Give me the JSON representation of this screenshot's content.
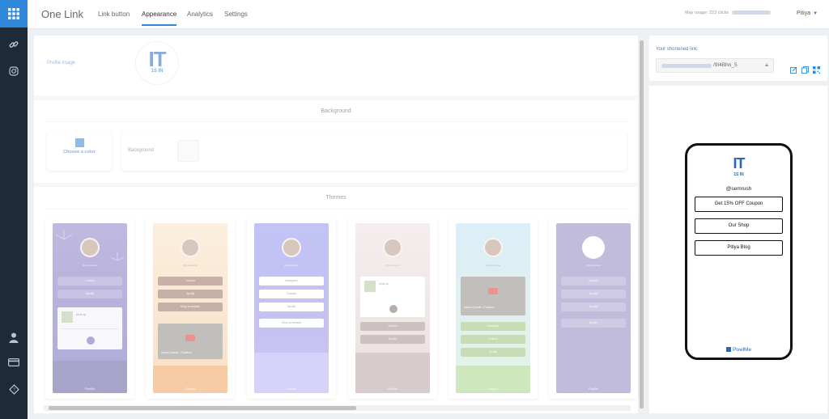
{
  "app": {
    "title": "One Link"
  },
  "tabs": [
    {
      "label": "Link button"
    },
    {
      "label": "Appearance"
    },
    {
      "label": "Analytics"
    },
    {
      "label": "Settings"
    }
  ],
  "header": {
    "usage_label": "May usage: 223 clicks",
    "user_name": "Pitiya"
  },
  "sidebar": {
    "icons": [
      "apps-grid-icon",
      "link-icon",
      "instagram-icon",
      "user-icon",
      "card-icon",
      "help-icon"
    ]
  },
  "profile": {
    "label": "Profile image",
    "logo_text": "IT",
    "logo_sub": "1S IN"
  },
  "background": {
    "title": "Background",
    "choose_label": "Choose a color",
    "field_label": "Background",
    "swatch_color": "#2f88d9"
  },
  "themes": {
    "title": "Themes",
    "handle": "@brandname",
    "footer": "PixelMe",
    "items": [
      {
        "buttons": [
          "Youtube",
          "Spotify"
        ],
        "track": "what up",
        "color": "#8c7fc6"
      },
      {
        "buttons": [
          "Youtube",
          "Spotify",
          "Shop at website"
        ],
        "video": "Ariana Grande - Positions",
        "color": "#f5d1a6"
      },
      {
        "buttons": [
          "Instagram",
          "Youtube",
          "Spotify",
          "Shop at website"
        ],
        "color": "#8f92ee"
      },
      {
        "buttons": [
          "Youtube",
          "Spotify"
        ],
        "track": "what up",
        "color": "#e9d3d3"
      },
      {
        "buttons": [
          "Instagram",
          "Youtube",
          "Spotify"
        ],
        "video": "Ariana Grande - Positions",
        "color": "#bfe0f1"
      },
      {
        "buttons": [
          "Youtube",
          "Spotify",
          "Spotify",
          "Spotify"
        ],
        "color": "#8f86c0"
      }
    ]
  },
  "share": {
    "label": "Your shortened link:",
    "url_suffix": "/9I4Bhn_5"
  },
  "preview": {
    "handle": "@semrush",
    "buttons": [
      "Get 15% OFF Coupon",
      "Our Shop",
      "Pitiya Blog"
    ],
    "footer": "PixelMe"
  }
}
